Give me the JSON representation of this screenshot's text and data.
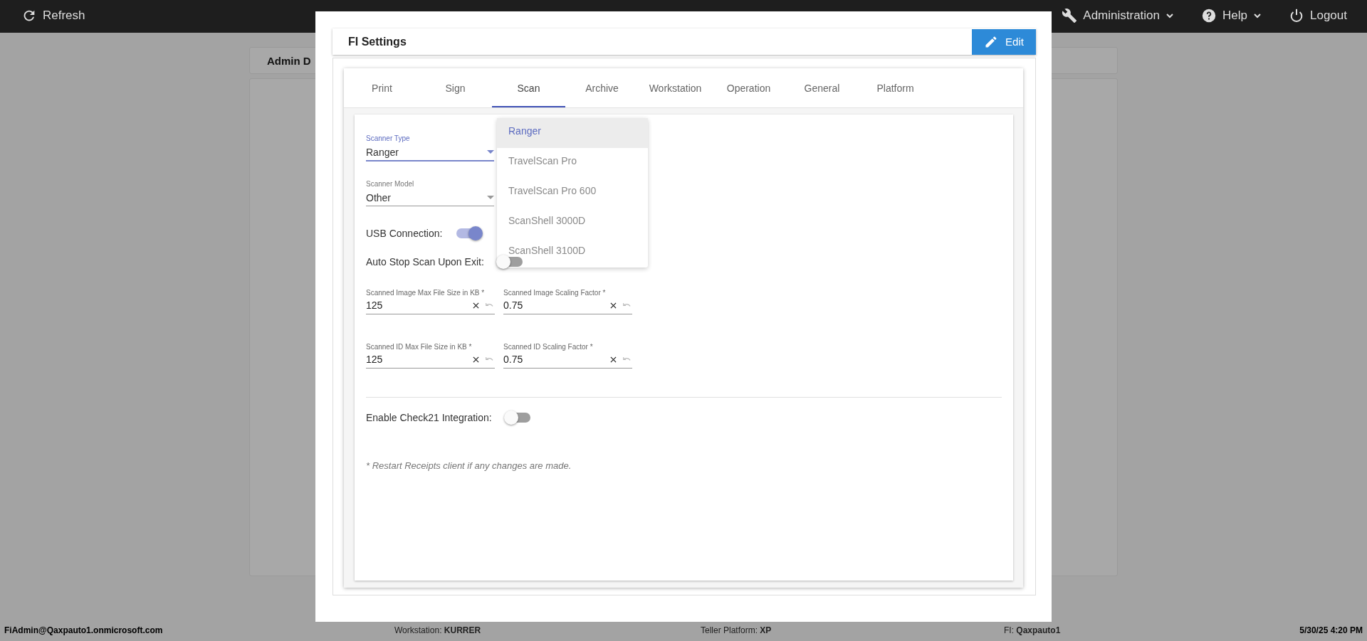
{
  "top_bar": {
    "refresh": "Refresh",
    "menus": [
      "Administration",
      "Help"
    ],
    "logout": "Logout"
  },
  "background_card": {
    "title": "Admin D"
  },
  "dialog": {
    "title": "FI Settings",
    "edit_button": "Edit",
    "tabs": [
      {
        "label": "Print",
        "selected": false
      },
      {
        "label": "Sign",
        "selected": false
      },
      {
        "label": "Scan",
        "selected": true
      },
      {
        "label": "Archive",
        "selected": false
      },
      {
        "label": "Workstation",
        "selected": false
      },
      {
        "label": "Operation",
        "selected": false
      },
      {
        "label": "General",
        "selected": false
      },
      {
        "label": "Platform",
        "selected": false
      }
    ],
    "scan": {
      "dropdown_menu": [
        {
          "label": "Ranger",
          "selected": true
        },
        {
          "label": "TravelScan Pro",
          "selected": false
        },
        {
          "label": "TravelScan Pro 600",
          "selected": false
        },
        {
          "label": "ScanShell 3000D",
          "selected": false
        },
        {
          "label": "ScanShell 3100D",
          "selected": false
        }
      ],
      "selects": [
        {
          "label": "Scanner Type",
          "value": "Ranger",
          "focused": true
        },
        {
          "label": "Scanner Model",
          "value": "Other",
          "focused": false
        }
      ],
      "toggles_top": [
        {
          "label": "USB Connection:",
          "on": true
        },
        {
          "label": "Auto Stop Scan Upon Exit:",
          "on": false
        }
      ],
      "field_rows": [
        [
          {
            "label": "Scanned Image Max File Size in KB *",
            "value": "125"
          },
          {
            "label": "Scanned Image Scaling Factor *",
            "value": "0.75"
          }
        ],
        [
          {
            "label": "Scanned ID Max File Size in KB *",
            "value": "125"
          },
          {
            "label": "Scanned ID Scaling Factor *",
            "value": "0.75"
          }
        ]
      ],
      "toggles_bottom": [
        {
          "label": "Enable Check21 Integration:",
          "on": false
        }
      ],
      "note": "* Restart Receipts client if any changes are made."
    }
  },
  "status_bar": {
    "user": "FiAdmin@Qaxpauto1.onmicrosoft.com",
    "items": [
      {
        "label": "Workstation:",
        "value": "KURRER"
      },
      {
        "label": "Teller Platform:",
        "value": "XP"
      },
      {
        "label": "FI:",
        "value": "Qaxpauto1"
      }
    ],
    "datetime": "5/30/25 4:20 PM"
  }
}
